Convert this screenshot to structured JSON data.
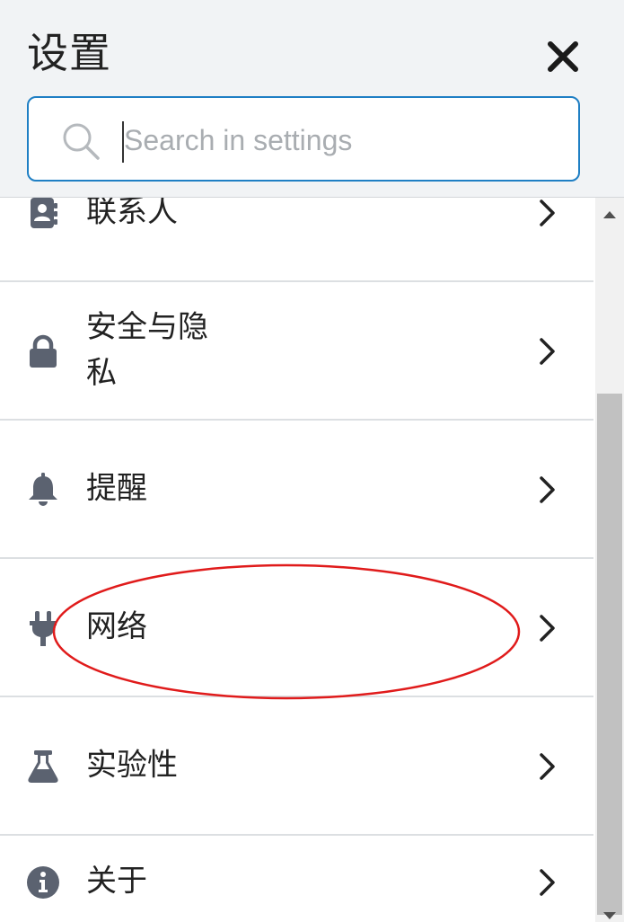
{
  "header": {
    "title": "设置",
    "close_icon": "close-icon"
  },
  "search": {
    "placeholder": "Search in settings",
    "icon": "search-icon"
  },
  "settings_items": [
    {
      "label": "联系人",
      "icon": "contact-book-icon"
    },
    {
      "label": "安全与隐私",
      "icon": "lock-icon"
    },
    {
      "label": "提醒",
      "icon": "bell-icon"
    },
    {
      "label": "网络",
      "icon": "plug-icon"
    },
    {
      "label": "实验性",
      "icon": "flask-icon"
    },
    {
      "label": "关于",
      "icon": "info-icon"
    }
  ],
  "colors": {
    "accent": "#1f7fc4",
    "header_bg": "#f1f3f5",
    "icon": "#5b6270",
    "annotation": "#e01b1b"
  }
}
